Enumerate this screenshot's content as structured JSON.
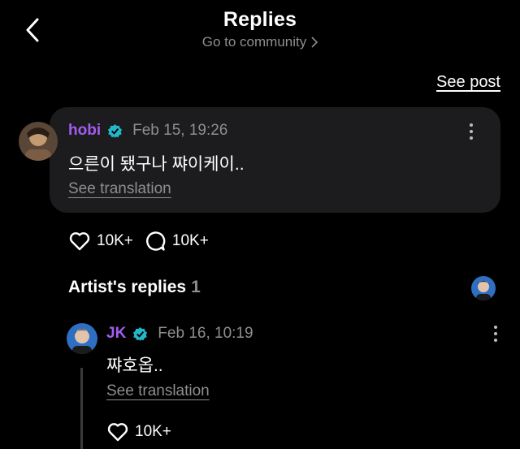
{
  "header": {
    "title": "Replies",
    "subtitle": "Go to community",
    "see_post": "See post"
  },
  "comment": {
    "author": "hobi",
    "date": "Feb 15, 19:26",
    "text": "으른이 됐구나 쨔이케이..",
    "see_translation": "See translation",
    "likes": "10K+",
    "replies": "10K+"
  },
  "artist_replies": {
    "title": "Artist's replies",
    "count": "1"
  },
  "reply": {
    "author": "JK",
    "date": "Feb 16, 10:19",
    "text": "쨔호옵..",
    "see_translation": "See translation",
    "likes": "10K+"
  },
  "colors": {
    "background": "#000000",
    "bubble": "#1c1c1e",
    "author": "#a45cf0",
    "verified": "#22b8c9",
    "muted": "#8e8e8e"
  }
}
